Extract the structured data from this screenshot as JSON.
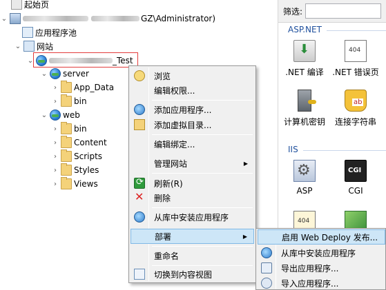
{
  "tree": {
    "start_page": "起始页",
    "server_node_suffix": "GZ\\Administrator)",
    "app_pools": "应用程序池",
    "sites": "网站",
    "site_name_blurred_end": "_Test",
    "children": [
      {
        "label": "server",
        "type": "globe",
        "expanded": true
      },
      {
        "label": "App_Data",
        "type": "folder"
      },
      {
        "label": "bin",
        "type": "folder"
      },
      {
        "label": "web",
        "type": "globe",
        "expanded": true
      },
      {
        "label": "bin",
        "type": "folder"
      },
      {
        "label": "Content",
        "type": "folder"
      },
      {
        "label": "Scripts",
        "type": "folder"
      },
      {
        "label": "Styles",
        "type": "folder"
      },
      {
        "label": "Views",
        "type": "folder"
      }
    ],
    "highlight_color": "#e23b3b"
  },
  "right_pane": {
    "filter_label": "筛选:",
    "section_aspnet": "ASP.NET",
    "section_iis": "IIS",
    "features": [
      {
        "label": ".NET 编译",
        "icon": "net-compile-icon"
      },
      {
        "label": ".NET 错误页",
        "icon": "net-error-pages-icon"
      },
      {
        "label": "计算机密钥",
        "icon": "machine-key-icon"
      },
      {
        "label": "连接字符串",
        "icon": "connection-strings-icon"
      },
      {
        "label": "ASP",
        "icon": "asp-icon"
      },
      {
        "label": "CGI",
        "icon": "cgi-icon"
      }
    ],
    "section_color": "#1e4f9c"
  },
  "context_menu": {
    "items": [
      {
        "label": "浏览",
        "icon": "browse-icon"
      },
      {
        "label": "编辑权限...",
        "icon": ""
      },
      {
        "label": "添加应用程序...",
        "icon": "add-application-icon"
      },
      {
        "label": "添加虚拟目录...",
        "icon": "add-virtual-directory-icon"
      },
      {
        "label": "编辑绑定...",
        "icon": ""
      },
      {
        "label": "管理网站",
        "icon": "",
        "submenu": true
      },
      {
        "label": "刷新(R)",
        "icon": "refresh-icon"
      },
      {
        "label": "删除",
        "icon": "delete-icon"
      },
      {
        "label": "从库中安装应用程序",
        "icon": "install-from-gallery-icon"
      },
      {
        "label": "部署",
        "icon": "",
        "submenu": true,
        "highlighted": true
      },
      {
        "label": "重命名",
        "icon": ""
      },
      {
        "label": "切换到内容视图",
        "icon": "content-view-icon"
      }
    ],
    "highlight_color": "#cde6f7"
  },
  "deploy_submenu": {
    "items": [
      {
        "label": "启用 Web Deploy 发布...",
        "highlighted": true
      },
      {
        "label": "从库中安装应用程序"
      },
      {
        "label": "导出应用程序..."
      },
      {
        "label": "导入应用程序..."
      }
    ]
  }
}
